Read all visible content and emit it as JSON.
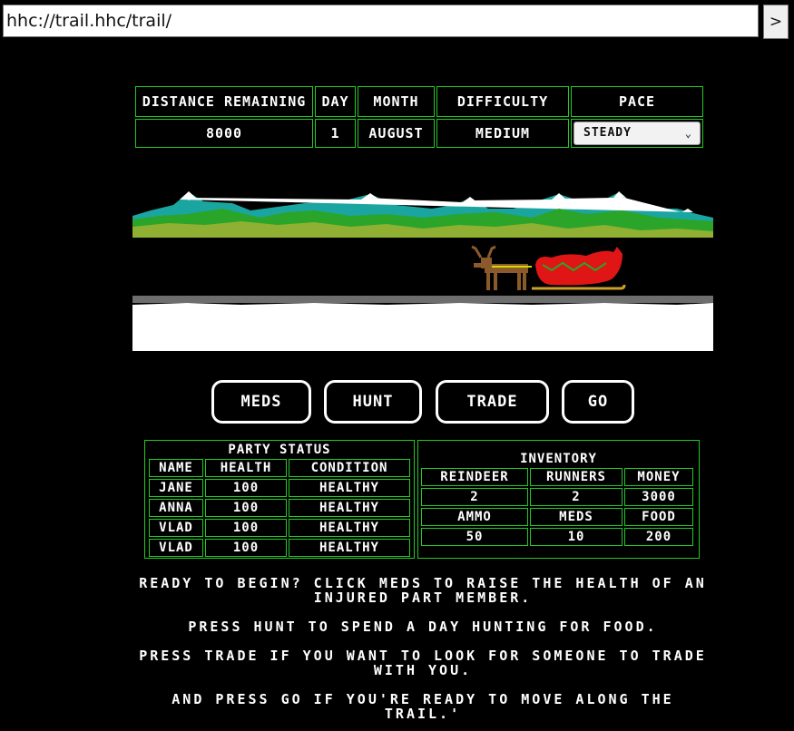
{
  "browser": {
    "url": "hhc://trail.hhc/trail/",
    "go_label": ">"
  },
  "status": {
    "headers": {
      "distance": "DISTANCE REMAINING",
      "day": "DAY",
      "month": "MONTH",
      "difficulty": "DIFFICULTY",
      "pace": "PACE"
    },
    "values": {
      "distance": "8000",
      "day": "1",
      "month": "AUGUST",
      "difficulty": "MEDIUM",
      "pace": "STEADY"
    }
  },
  "actions": {
    "meds": "MEDS",
    "hunt": "HUNT",
    "trade": "TRADE",
    "go": "GO"
  },
  "party": {
    "title": "PARTY STATUS",
    "columns": [
      "NAME",
      "HEALTH",
      "CONDITION"
    ],
    "members": [
      {
        "name": "JANE",
        "health": "100",
        "condition": "HEALTHY"
      },
      {
        "name": "ANNA",
        "health": "100",
        "condition": "HEALTHY"
      },
      {
        "name": "VLAD",
        "health": "100",
        "condition": "HEALTHY"
      },
      {
        "name": "VLAD",
        "health": "100",
        "condition": "HEALTHY"
      }
    ]
  },
  "inventory": {
    "title": "INVENTORY",
    "row1_labels": [
      "REINDEER",
      "RUNNERS",
      "MONEY"
    ],
    "row1_values": [
      "2",
      "2",
      "3000"
    ],
    "row2_labels": [
      "AMMO",
      "MEDS",
      "FOOD"
    ],
    "row2_values": [
      "50",
      "10",
      "200"
    ]
  },
  "instructions": {
    "p1": "READY TO BEGIN? CLICK MEDS TO RAISE THE HEALTH OF AN INJURED PART MEMBER.",
    "p2": "PRESS HUNT TO SPEND A DAY HUNTING FOR FOOD.",
    "p3": "PRESS TRADE IF YOU WANT TO LOOK FOR SOMEONE TO TRADE WITH YOU.",
    "p4": "AND PRESS GO IF YOU'RE READY TO MOVE ALONG THE TRAIL.'"
  },
  "colors": {
    "border_green": "#24c924",
    "sleigh_red": "#e01515",
    "snow": "#ffffff",
    "grass": "#2aa52a"
  },
  "icons": {
    "pace_dropdown": "chevron-down-icon",
    "reindeer": "reindeer-icon",
    "sleigh": "sleigh-icon"
  }
}
